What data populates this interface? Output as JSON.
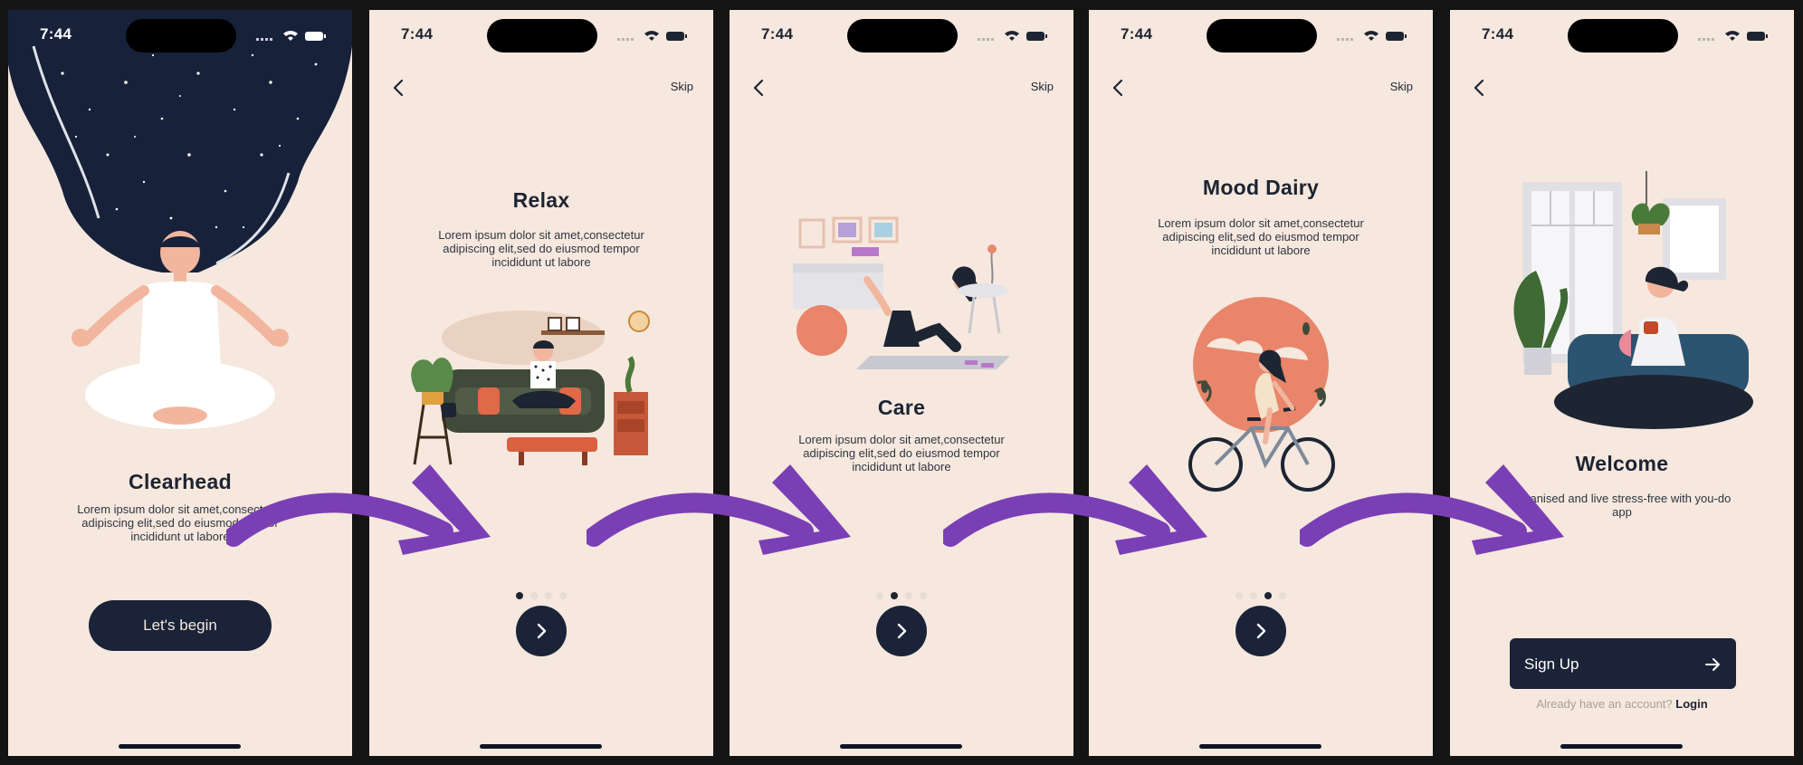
{
  "status": {
    "time": "7:44"
  },
  "nav": {
    "skip": "Skip"
  },
  "screens": [
    {
      "title": "Clearhead",
      "description": "Lorem ipsum dolor sit amet,consectetur adipiscing elit,sed do eiusmod tempor incididunt ut labore",
      "button": "Let's begin"
    },
    {
      "title": "Relax",
      "description": "Lorem ipsum dolor sit amet,consectetur adipiscing elit,sed do eiusmod tempor incididunt ut labore"
    },
    {
      "title": "Care",
      "description": "Lorem ipsum dolor sit amet,consectetur adipiscing elit,sed do eiusmod tempor incididunt ut labore"
    },
    {
      "title": "Mood Dairy",
      "description": "Lorem ipsum dolor sit amet,consectetur adipiscing elit,sed do eiusmod tempor incididunt ut labore"
    },
    {
      "title": "Welcome",
      "description": "organised and live stress-free with you-do app",
      "button": "Sign Up",
      "login_prompt": "Already have an account?",
      "login_link": "Login"
    }
  ],
  "colors": {
    "background": "#f6e8de",
    "primary": "#1a2337",
    "arrow": "#7b3fb5",
    "illustration_accent": "#e68a6c"
  },
  "icons": [
    "back-chevron-icon",
    "signal-icon",
    "wifi-icon",
    "battery-icon",
    "chevron-right-icon",
    "arrow-right-icon"
  ]
}
